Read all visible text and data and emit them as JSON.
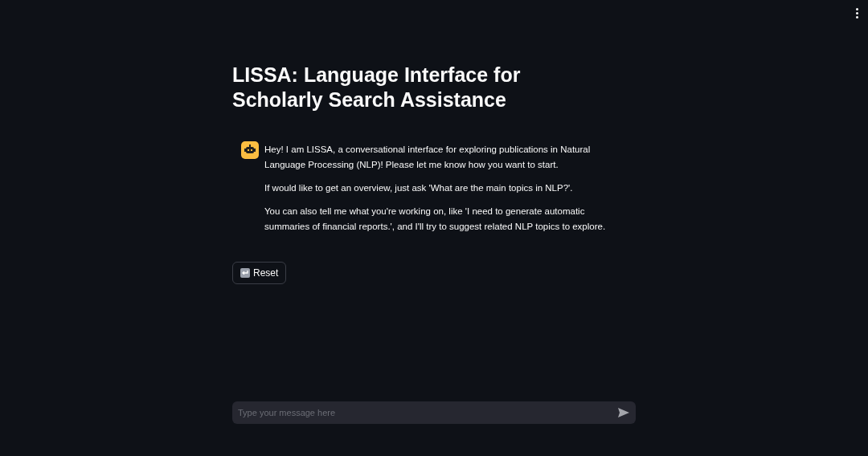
{
  "title": "LISSA: Language Interface for Scholarly Search Assistance",
  "messages": [
    {
      "kind": "assistant",
      "paragraphs": [
        "Hey! I am LISSA, a conversational interface for exploring publications in Natural Language Processing (NLP)! Please let me know how you want to start.",
        "If would like to get an overview, just ask 'What are the main topics in NLP?'.",
        "You can also tell me what you're working on, like 'I need to generate automatic summaries of financial reports.', and I'll try to suggest related NLP topics to explore."
      ]
    }
  ],
  "reset_button": {
    "label": "Reset"
  },
  "chat_input": {
    "placeholder": "Type your message here"
  }
}
